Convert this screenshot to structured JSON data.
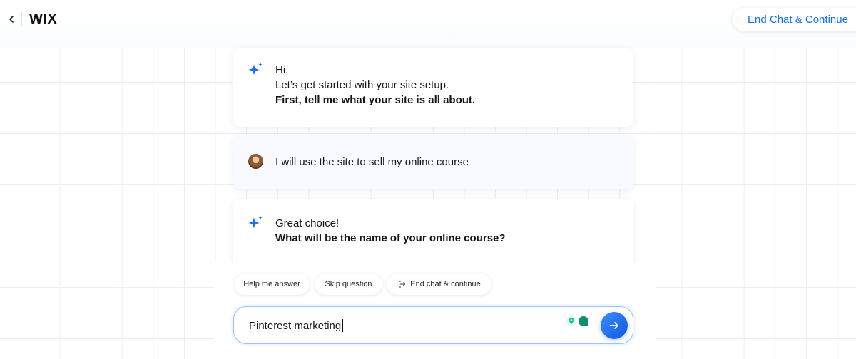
{
  "header": {
    "logo": "WIX",
    "end_chat_button": "End Chat & Continue"
  },
  "chat": {
    "messages": [
      {
        "sender": "assistant",
        "lines": [
          "Hi,",
          "Let’s get started with your site setup."
        ],
        "bold": "First, tell me what your site is all about."
      },
      {
        "sender": "user",
        "text": "I will use the site to sell my online course"
      },
      {
        "sender": "assistant",
        "lines": [
          "Great choice!"
        ],
        "bold": "What will be the name of your online course?"
      }
    ]
  },
  "quick_actions": {
    "help": "Help me answer",
    "skip": "Skip question",
    "end": "End chat & continue"
  },
  "composer": {
    "value": "Pinterest marketing"
  },
  "colors": {
    "accent": "#116dff",
    "send_button": "#1668f0",
    "sparkle": "#1f6ff2"
  },
  "icons": [
    "back-chevron-icon",
    "sparkle-icon",
    "user-avatar",
    "exit-icon",
    "grammar-icon",
    "arrow-right-icon"
  ]
}
